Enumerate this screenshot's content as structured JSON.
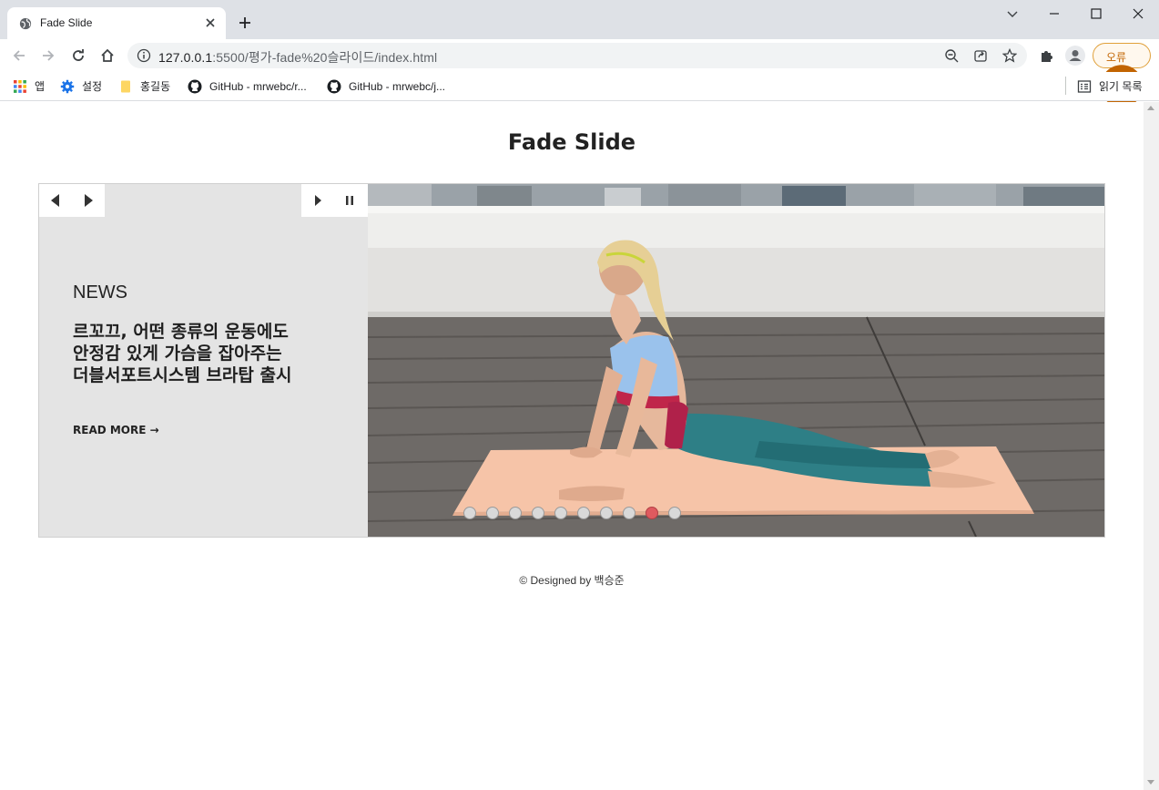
{
  "browser": {
    "tab_title": "Fade Slide",
    "url_host": "127.0.0.1",
    "url_path": ":5500/평가-fade%20슬라이드/index.html",
    "error_button_label": "오류",
    "bookmarks": [
      {
        "label": "앱",
        "icon": "apps-grid-icon"
      },
      {
        "label": "설정",
        "icon": "gear-icon"
      },
      {
        "label": "홍길동",
        "icon": "folder-icon"
      },
      {
        "label": "GitHub - mrwebc/r...",
        "icon": "github-icon"
      },
      {
        "label": "GitHub - mrwebc/j...",
        "icon": "github-icon"
      }
    ],
    "reading_list_label": "읽기 목록"
  },
  "page": {
    "title": "Fade Slide",
    "slider": {
      "category": "NEWS",
      "headline_lines": [
        "르꼬끄, 어떤 종류의 운동에도",
        "안정감 있게 가슴을 잡아주는",
        "더블서포트시스템 브라탑 출시"
      ],
      "read_more": "READ MORE →",
      "slide_count": 10,
      "active_slide_index": 8,
      "photo_alt": "woman doing yoga cobra pose on a peach mat on a rooftop deck",
      "colors": {
        "active_dot": "#e05a5f",
        "inactive_dot": "#d9d9d9",
        "panel_bg": "#e4e4e4"
      }
    },
    "footer": "© Designed by 백승준"
  }
}
